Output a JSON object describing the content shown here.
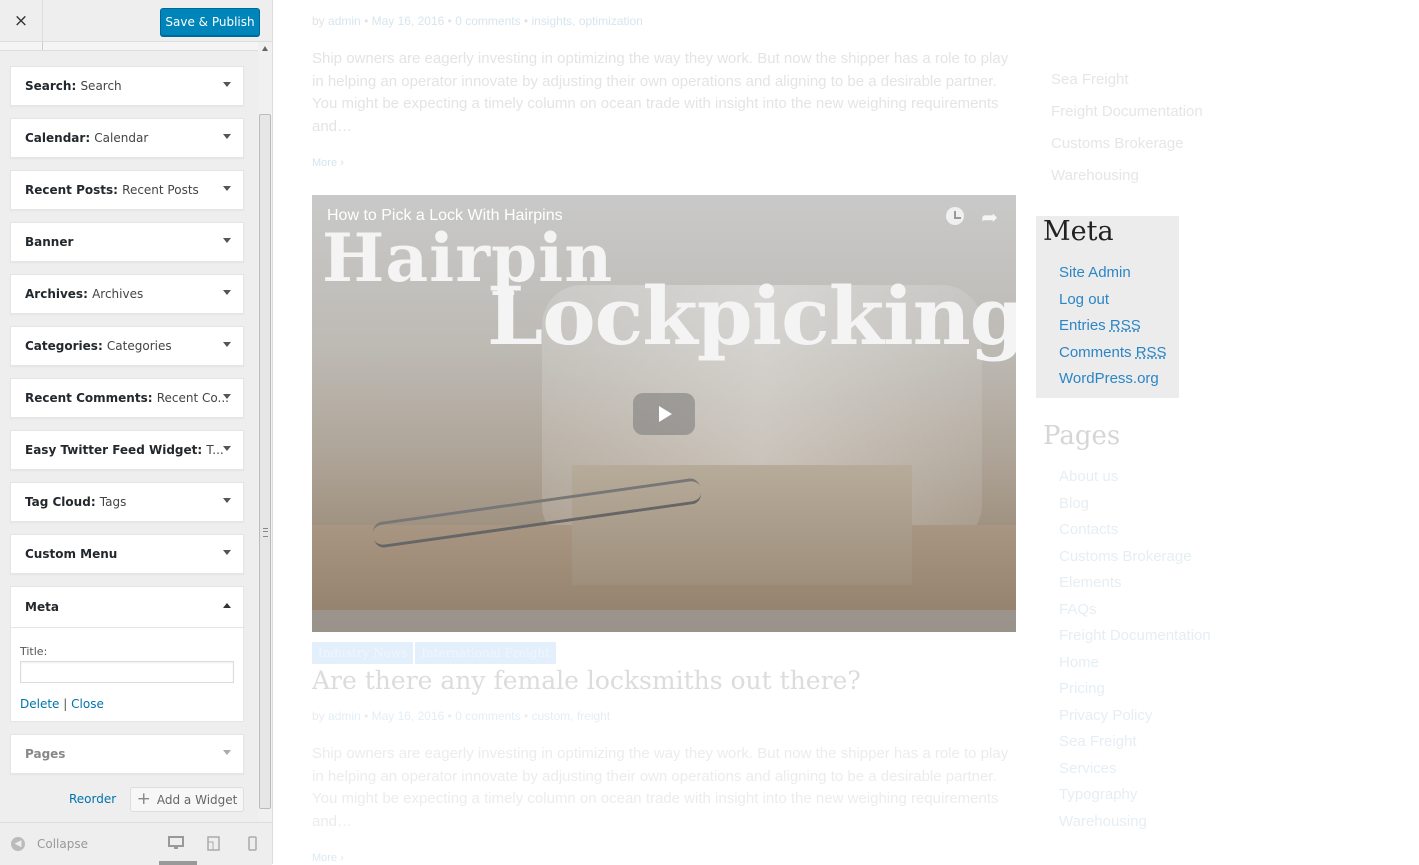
{
  "header": {
    "close_label": "×",
    "save_label": "Save & Publish"
  },
  "widgets": [
    {
      "type": "Search",
      "instance": "Search"
    },
    {
      "type": "Calendar",
      "instance": "Calendar"
    },
    {
      "type": "Recent Posts",
      "instance": "Recent Posts"
    },
    {
      "type": "Banner",
      "instance": ""
    },
    {
      "type": "Archives",
      "instance": "Archives"
    },
    {
      "type": "Categories",
      "instance": "Categories"
    },
    {
      "type": "Recent Comments",
      "instance": "Recent Co..."
    },
    {
      "type": "Easy Twitter Feed Widget",
      "instance": "T..."
    },
    {
      "type": "Tag Cloud",
      "instance": "Tags"
    },
    {
      "type": "Custom Menu",
      "instance": ""
    }
  ],
  "meta_form": {
    "title": "Meta",
    "field_label": "Title:",
    "field_value": "",
    "delete_label": "Delete",
    "separator": "|",
    "close_label": "Close"
  },
  "pages_widget": {
    "title": "Pages"
  },
  "sidebar_footer": {
    "reorder_label": "Reorder",
    "add_widget_label": "Add a Widget",
    "collapse_label": "Collapse",
    "selected_device": "desktop"
  },
  "preview": {
    "post1": {
      "by": "by",
      "author": "admin",
      "date": "May 16, 2016",
      "comments": "0 comments",
      "tags": "insights, optimization",
      "excerpt": "Ship owners are eagerly investing in optimizing the way they work. But now the shipper has a role to play in helping an operator innovate by adjusting their own operations and aligning to be a desirable partner. You might be expecting a timely column on ocean trade with insight into the new weighing requirements and…",
      "more": "More"
    },
    "video": {
      "title": "How to Pick a Lock With Hairpins",
      "overlay_line1": "Hairpin",
      "overlay_line2": "Lockpicking"
    },
    "post2": {
      "categories": [
        "Industry News",
        "International Freight"
      ],
      "title": "Are there any female locksmiths out there?",
      "by": "by",
      "author": "admin",
      "date": "May 16, 2016",
      "comments": "0 comments",
      "tags": "custom, freight",
      "excerpt": "Ship owners are eagerly investing in optimizing the way they work. But now the shipper has a role to play in helping an operator innovate by adjusting their own operations and aligning to be a desirable partner. You might be expecting a timely column on ocean trade with insight into the new weighing requirements and…",
      "more": "More"
    },
    "category_links": [
      "Sea Freight",
      "Freight Documentation",
      "Customs Brokerage",
      "Warehousing"
    ],
    "meta_widget": {
      "title": "Meta",
      "links": [
        "Site Admin",
        "Log out",
        "Entries",
        "Comments",
        "WordPress.org"
      ],
      "rss_abbr": "RSS"
    },
    "pages_widget": {
      "title": "Pages",
      "links": [
        "About us",
        "Blog",
        "Contacts",
        "Customs Brokerage",
        "Elements",
        "FAQs",
        "Freight Documentation",
        "Home",
        "Pricing",
        "Privacy Policy",
        "Sea Freight",
        "Services",
        "Typography",
        "Warehousing"
      ]
    }
  },
  "colors": {
    "accent": "#0085ba",
    "link": "#0073aa",
    "preview_link": "#2b86c5"
  }
}
